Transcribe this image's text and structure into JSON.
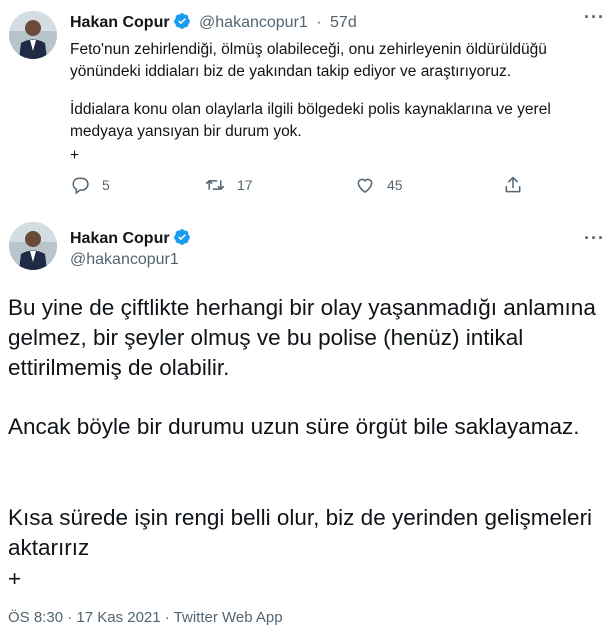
{
  "tweets": [
    {
      "author_name": "Hakan Copur",
      "handle": "@hakancopur1",
      "time_sep": "·",
      "time": "57d",
      "text": [
        "Feto'nun zehirlendiği, ölmüş olabileceği, onu zehirleyenin öldürüldüğü yönündeki iddiaları biz de yakından takip ediyor ve araştırıyoruz.",
        "İddialara konu olan olaylarla ilgili bölgedeki polis kaynaklarına ve yerel medyaya yansıyan bir durum yok.",
        "+"
      ],
      "actions": {
        "replies": "5",
        "retweets": "17",
        "likes": "45"
      },
      "more_label": "···",
      "verified_icon": "verified-badge-icon"
    },
    {
      "author_name": "Hakan Copur",
      "handle": "@hakancopur1",
      "text": [
        "Bu yine de çiftlikte herhangi bir olay yaşanmadığı anlamına gelmez, bir şeyler olmuş ve bu polise (henüz) intikal ettirilmemiş de olabilir.",
        "Ancak böyle bir durumu uzun süre örgüt bile saklayamaz.",
        "Kısa sürede işin rengi belli olur, biz de yerinden gelişmeleri aktarırız",
        "+"
      ],
      "meta": "ÖS 8:30 · 17 Kas 2021 · Twitter Web App",
      "more_label": "···",
      "verified_icon": "verified-badge-icon"
    }
  ],
  "colors": {
    "text": "#0f1419",
    "secondary": "#536471",
    "verified": "#1d9bf0"
  }
}
